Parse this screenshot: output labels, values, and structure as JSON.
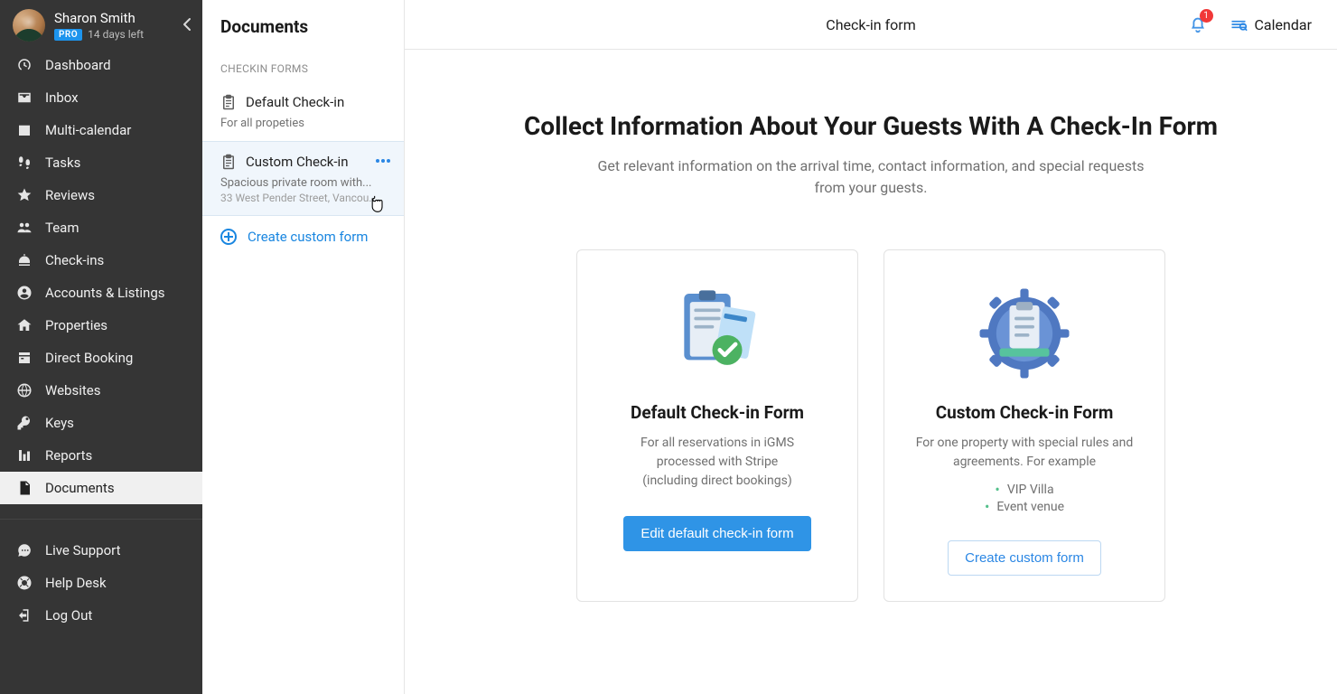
{
  "profile": {
    "name": "Sharon Smith",
    "badge": "PRO",
    "trial": "14 days left"
  },
  "nav": {
    "dashboard": "Dashboard",
    "inbox": "Inbox",
    "multi_calendar": "Multi-calendar",
    "tasks": "Tasks",
    "reviews": "Reviews",
    "team": "Team",
    "checkins": "Check-ins",
    "accounts": "Accounts & Listings",
    "properties": "Properties",
    "direct_booking": "Direct Booking",
    "websites": "Websites",
    "keys": "Keys",
    "reports": "Reports",
    "documents": "Documents",
    "live_support": "Live Support",
    "help_desk": "Help Desk",
    "log_out": "Log Out"
  },
  "panel": {
    "title": "Documents",
    "section_label": "CHECKIN FORMS",
    "items": [
      {
        "title": "Default Check-in",
        "sub1": "For all propeties"
      },
      {
        "title": "Custom Check-in",
        "sub1": "Spacious private room with...",
        "sub2": "33 West Pender Street, Vancou..."
      }
    ],
    "create": "Create custom form"
  },
  "topbar": {
    "title": "Check-in form",
    "calendar": "Calendar",
    "notif_count": "1"
  },
  "main": {
    "heading": "Collect Information About Your Guests With A Check-In Form",
    "subtitle": "Get relevant information on the arrival time, contact information, and special requests from your guests.",
    "card_default": {
      "title": "Default Check-in Form",
      "desc_line1": "For all reservations in iGMS",
      "desc_line2": "processed with Stripe",
      "desc_line3": "(including direct bookings)",
      "button": "Edit default check-in form"
    },
    "card_custom": {
      "title": "Custom Check-in Form",
      "desc_line1": "For one property with special rules and",
      "desc_line2": "agreements. For example",
      "bullet1": "VIP Villa",
      "bullet2": "Event venue",
      "button": "Create custom form"
    }
  }
}
